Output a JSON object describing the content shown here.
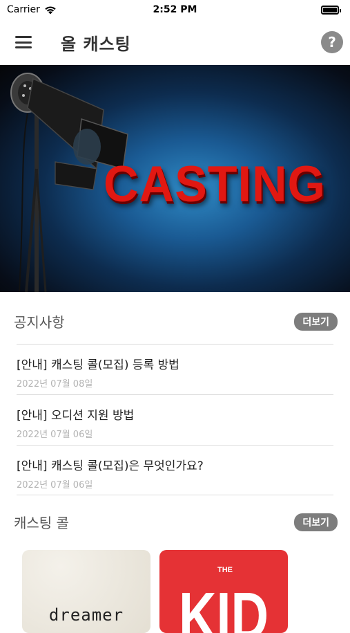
{
  "status_bar": {
    "carrier": "Carrier",
    "time": "2:52 PM"
  },
  "nav": {
    "title": "올 캐스팅",
    "help_label": "?"
  },
  "hero": {
    "text": "CASTING"
  },
  "notices": {
    "title": "공지사항",
    "more_label": "더보기",
    "items": [
      {
        "title": "[안내] 캐스팅 콜(모집) 등록 방법",
        "date": "2022년 07월 08일"
      },
      {
        "title": "[안내] 오디션 지원 방법",
        "date": "2022년 07월 06일"
      },
      {
        "title": "[안내] 캐스팅 콜(모집)은 무엇인가요?",
        "date": "2022년 07월 06일"
      }
    ]
  },
  "casting_calls": {
    "title": "캐스팅 콜",
    "more_label": "더보기",
    "cards": [
      {
        "text": "dreamer"
      },
      {
        "logo_small": "THE",
        "logo_big": "KID"
      }
    ]
  },
  "colors": {
    "accent_gray": "#7d7d7d",
    "hero_red": "#e11812",
    "kid_red": "#e53235"
  }
}
